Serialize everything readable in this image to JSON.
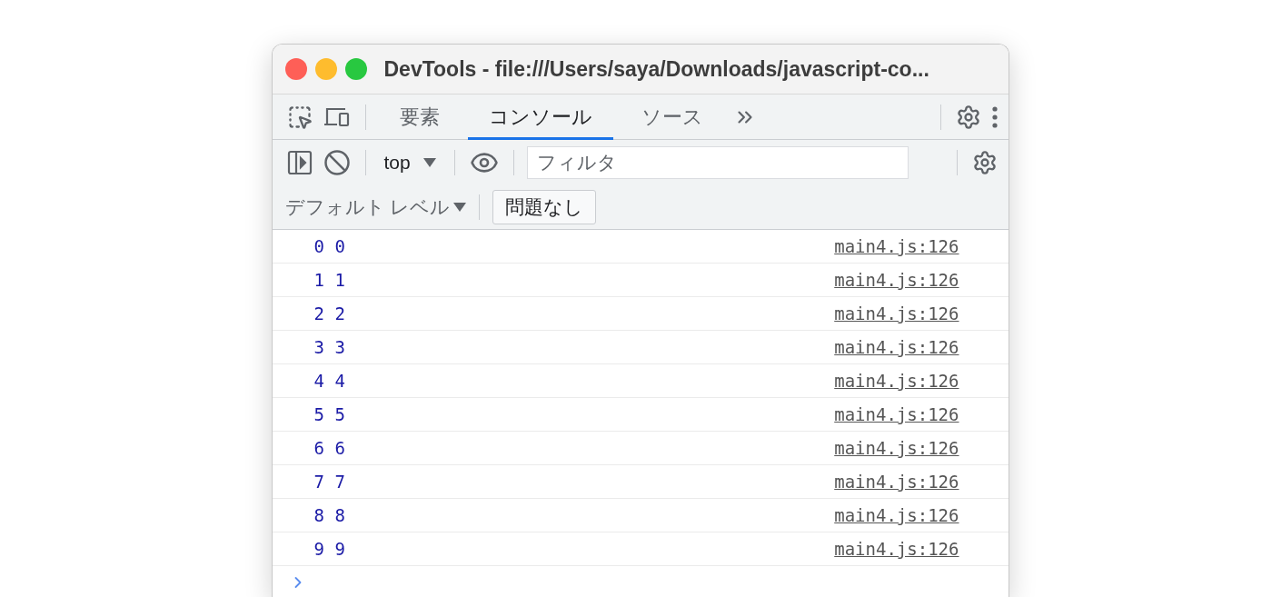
{
  "window": {
    "title": "DevTools - file:///Users/saya/Downloads/javascript-co..."
  },
  "tabs": [
    {
      "label": "要素",
      "selected": false
    },
    {
      "label": "コンソール",
      "selected": true
    },
    {
      "label": "ソース",
      "selected": false
    }
  ],
  "toolbar": {
    "context": "top",
    "filter": {
      "placeholder": "フィルタ"
    }
  },
  "levels": {
    "label": "デフォルト レベル",
    "issues_button": "問題なし"
  },
  "console": [
    {
      "text": "0 0",
      "source": "main4.js:126"
    },
    {
      "text": "1 1",
      "source": "main4.js:126"
    },
    {
      "text": "2 2",
      "source": "main4.js:126"
    },
    {
      "text": "3 3",
      "source": "main4.js:126"
    },
    {
      "text": "4 4",
      "source": "main4.js:126"
    },
    {
      "text": "5 5",
      "source": "main4.js:126"
    },
    {
      "text": "6 6",
      "source": "main4.js:126"
    },
    {
      "text": "7 7",
      "source": "main4.js:126"
    },
    {
      "text": "8 8",
      "source": "main4.js:126"
    },
    {
      "text": "9 9",
      "source": "main4.js:126"
    }
  ]
}
